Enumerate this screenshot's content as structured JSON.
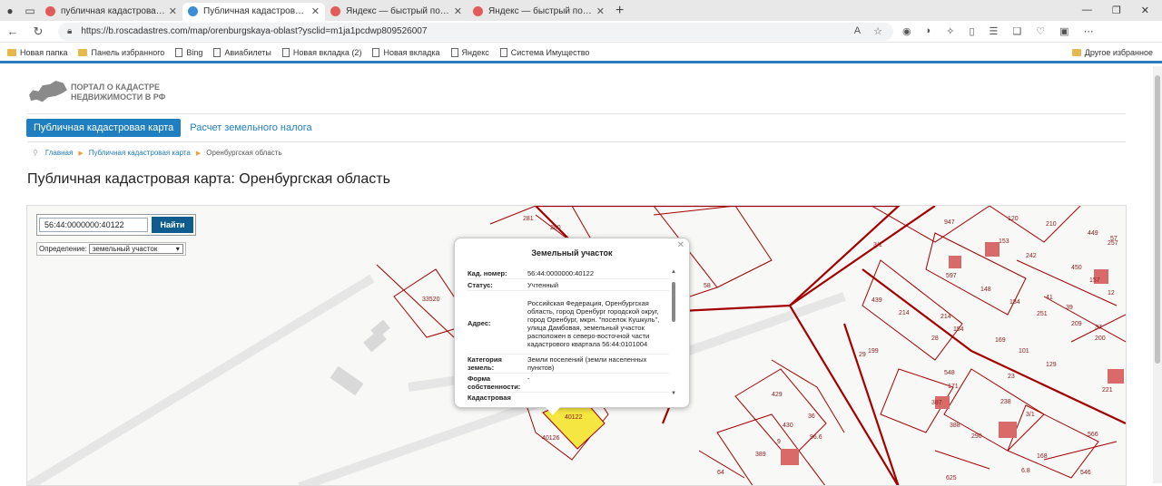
{
  "browser": {
    "tabs": [
      {
        "title": "публичная кадастровая карта о",
        "active": false
      },
      {
        "title": "Публичная кадастровая карта: О",
        "active": true
      },
      {
        "title": "Яндекс — быстрый поиск в инт",
        "active": false
      },
      {
        "title": "Яндекс — быстрый поиск в инте",
        "active": false
      }
    ],
    "url": "https://b.roscadastres.com/map/orenburgskaya-oblast?ysclid=m1ja1pcdwp809526007",
    "bookmarks": [
      "Новая папка",
      "Панель избранного",
      "Bing",
      "Авиабилеты",
      "Новая вкладка (2)",
      "Новая вкладка",
      "Яндекс",
      "Система Имущество"
    ],
    "other_bookmarks": "Другое избранное"
  },
  "site": {
    "logo_line1": "ПОРТАЛ О КАДАСТРЕ",
    "logo_line2": "НЕДВИЖИМОСТИ В РФ",
    "nav_active": "Публичная кадастровая карта",
    "nav_link": "Расчет земельного налога",
    "breadcrumbs": [
      "Главная",
      "Публичная кадастровая карта",
      "Оренбургская область"
    ],
    "title": "Публичная кадастровая карта: Оренбургская область"
  },
  "map": {
    "search_value": "56:44:0000000:40122",
    "search_button": "Найти",
    "def_label": "Определение:",
    "def_value": "земельный участок",
    "labels": [
      "281",
      "280",
      "33520",
      "58",
      "40122",
      "40126",
      "429",
      "430",
      "389",
      "36",
      "96.6",
      "9",
      "64",
      "120",
      "210",
      "449",
      "257",
      "57",
      "947",
      "3/1",
      "153",
      "242",
      "450",
      "157",
      "12",
      "597",
      "148",
      "184",
      "251",
      "209",
      "37",
      "200",
      "439",
      "214",
      "214",
      "28",
      "154",
      "169",
      "101",
      "129",
      "29",
      "199",
      "548",
      "387",
      "171",
      "238",
      "388",
      "290",
      "3/1",
      "221",
      "566",
      "168",
      "546",
      "625",
      "6.8",
      "41",
      "39",
      "23"
    ]
  },
  "popup": {
    "title": "Земельный участок",
    "rows": [
      {
        "k": "Кад. номер:",
        "v": "56:44:0000000:40122"
      },
      {
        "k": "Статус:",
        "v": "Учтенный"
      },
      {
        "k": "Адрес:",
        "v": "Российская Федерация, Оренбургская область, город Оренбург городской округ, город Оренбург, мкрн. \"поселок Кушкуль\", улица Дамбовая, земельный участок расположен в северо-восточной части кадастрового квартала 56:44:0101004"
      },
      {
        "k": "Категория земель:",
        "v": "Земли поселений (земли населенных пунктов)"
      },
      {
        "k": "Форма собственности:",
        "v": "-"
      },
      {
        "k": "Кадастровая",
        "v": ""
      }
    ]
  }
}
